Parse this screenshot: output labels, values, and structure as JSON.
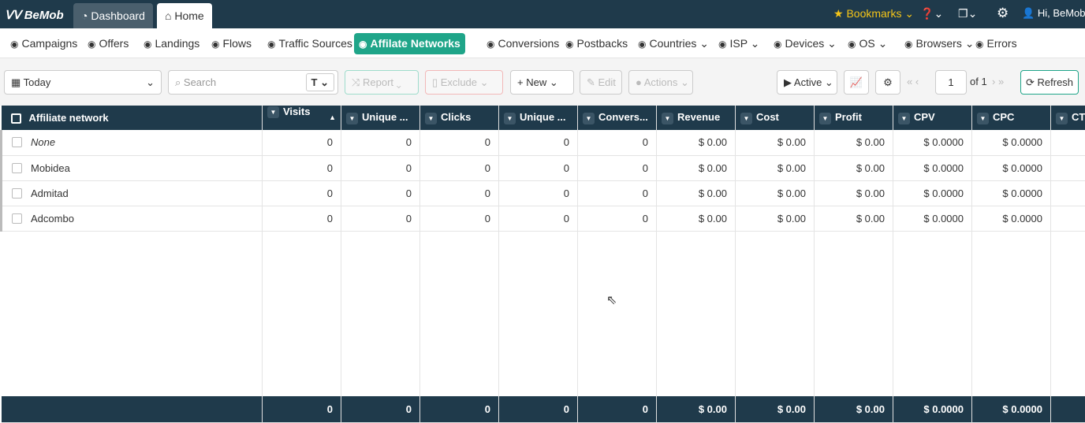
{
  "topbar": {
    "logo": "BeMob",
    "tabs": [
      "Dashboard",
      "Home"
    ],
    "bookmarks": "Bookmarks",
    "user": "Hi, BeMob"
  },
  "nav": {
    "items": [
      {
        "label": "Campaigns",
        "icon": "target-icon"
      },
      {
        "label": "Offers",
        "icon": "dollar-badge-icon"
      },
      {
        "label": "Landings",
        "icon": "window-icon"
      },
      {
        "label": "Flows",
        "icon": "sitemap-icon"
      },
      {
        "label": "Traffic Sources",
        "icon": "globe-icon"
      },
      {
        "label": "Affilate Networks",
        "icon": "network-icon",
        "active": true
      },
      {
        "label": "Conversions",
        "icon": "dollar-icon"
      },
      {
        "label": "Postbacks",
        "icon": "download-icon"
      },
      {
        "label": "Countries ⌄",
        "icon": "globe-icon"
      },
      {
        "label": "ISP ⌄",
        "icon": "wifi-icon"
      },
      {
        "label": "Devices ⌄",
        "icon": "laptop-icon"
      },
      {
        "label": "OS ⌄",
        "icon": "mobile-icon"
      },
      {
        "label": "Browsers ⌄",
        "icon": "window-icon"
      },
      {
        "label": "Errors",
        "icon": "exclamation-icon"
      }
    ]
  },
  "toolbar": {
    "date": "Today",
    "search_placeholder": "Search",
    "report": "Report",
    "exclude": "Exclude",
    "new": "New",
    "edit": "Edit",
    "actions": "Actions",
    "status": "Active",
    "page": "1",
    "of": "of 1",
    "refresh": "Refresh"
  },
  "table": {
    "columns": [
      "Affiliate network",
      "Visits",
      "Unique ...",
      "Clicks",
      "Unique ...",
      "Convers...",
      "Revenue",
      "Cost",
      "Profit",
      "CPV",
      "CPC",
      "CTR"
    ],
    "rows": [
      [
        "None",
        "0",
        "0",
        "0",
        "0",
        "0",
        "$ 0.00",
        "$ 0.00",
        "$ 0.00",
        "$ 0.0000",
        "$ 0.0000"
      ],
      [
        "Mobidea",
        "0",
        "0",
        "0",
        "0",
        "0",
        "$ 0.00",
        "$ 0.00",
        "$ 0.00",
        "$ 0.0000",
        "$ 0.0000"
      ],
      [
        "Admitad",
        "0",
        "0",
        "0",
        "0",
        "0",
        "$ 0.00",
        "$ 0.00",
        "$ 0.00",
        "$ 0.0000",
        "$ 0.0000"
      ],
      [
        "Adcombo",
        "0",
        "0",
        "0",
        "0",
        "0",
        "$ 0.00",
        "$ 0.00",
        "$ 0.00",
        "$ 0.0000",
        "$ 0.0000"
      ]
    ],
    "totals": [
      "",
      "0",
      "0",
      "0",
      "0",
      "0",
      "$ 0.00",
      "$ 0.00",
      "$ 0.00",
      "$ 0.0000",
      "$ 0.0000"
    ]
  },
  "colors": {
    "header": "#1f3a4b",
    "accent": "#1fa589",
    "bookmarks": "#f5c518"
  }
}
